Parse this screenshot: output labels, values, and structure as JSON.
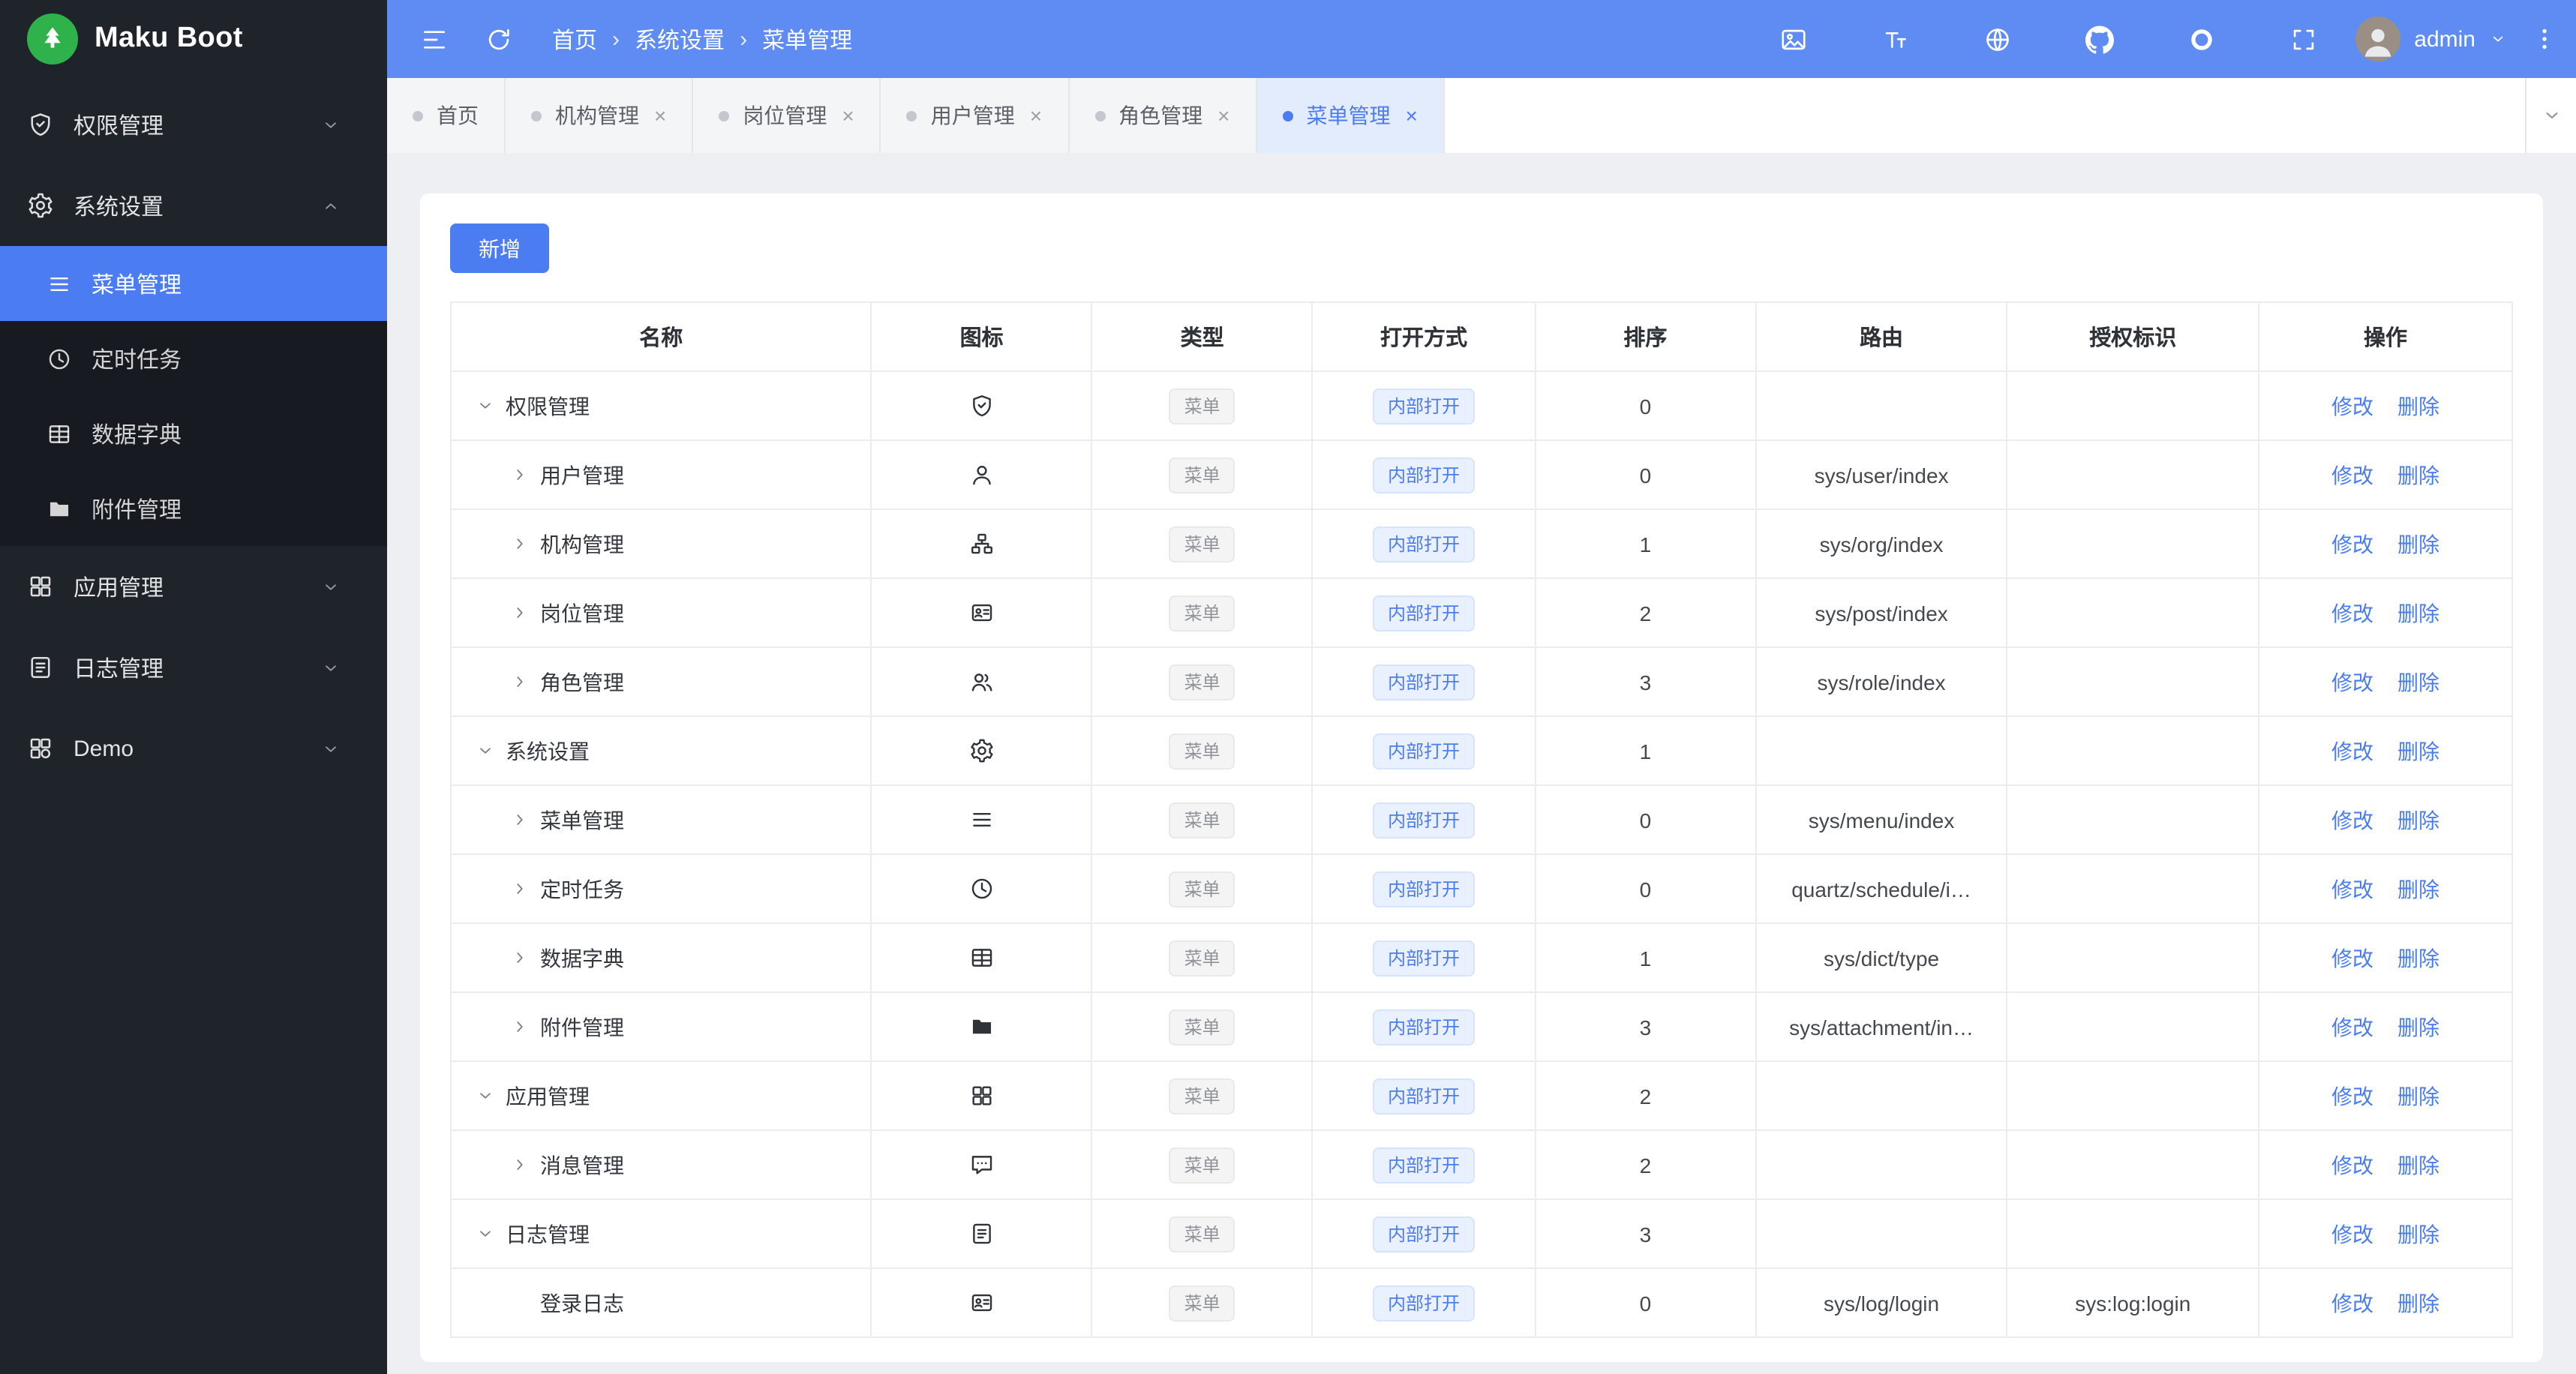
{
  "app": {
    "title": "Maku Boot",
    "logo_icon": "tree"
  },
  "colors": {
    "topbar": "#5f8cf3",
    "accent": "#4b7cf2",
    "sidebar_bg": "#1f232a",
    "submenu_bg": "#171a20",
    "logo_green": "#2fb24c",
    "content_bg": "#edeff3",
    "tag_gray_text": "#8f9399",
    "tag_blue_text": "#4b7cf2"
  },
  "header": {
    "left_icons": [
      "menu-fold",
      "refresh"
    ],
    "breadcrumb": [
      "首页",
      "系统设置",
      "菜单管理"
    ],
    "breadcrumb_separator": "›",
    "right_icons": [
      "image",
      "font-size",
      "globe",
      "github",
      "theme",
      "fullscreen"
    ],
    "user": "admin"
  },
  "sidebar": {
    "items": [
      {
        "label": "权限管理",
        "icon": "shield",
        "chevron": "down"
      },
      {
        "label": "系统设置",
        "icon": "gear",
        "chevron": "up",
        "children": [
          {
            "label": "菜单管理",
            "icon": "menu",
            "active": true
          },
          {
            "label": "定时任务",
            "icon": "clock"
          },
          {
            "label": "数据字典",
            "icon": "dict"
          },
          {
            "label": "附件管理",
            "icon": "folder"
          }
        ]
      },
      {
        "label": "应用管理",
        "icon": "apps",
        "chevron": "down"
      },
      {
        "label": "日志管理",
        "icon": "log",
        "chevron": "down"
      },
      {
        "label": "Demo",
        "icon": "demo",
        "chevron": "down"
      }
    ]
  },
  "tabs": {
    "close_glyph": "×",
    "items": [
      {
        "label": "首页",
        "closable": false
      },
      {
        "label": "机构管理",
        "closable": true
      },
      {
        "label": "岗位管理",
        "closable": true
      },
      {
        "label": "用户管理",
        "closable": true
      },
      {
        "label": "角色管理",
        "closable": true
      },
      {
        "label": "菜单管理",
        "closable": true,
        "active": true
      }
    ]
  },
  "toolbar": {
    "add_label": "新增"
  },
  "table": {
    "headers": [
      "名称",
      "图标",
      "类型",
      "打开方式",
      "排序",
      "路由",
      "授权标识",
      "操作"
    ],
    "type_tag": "菜单",
    "open_tag": "内部打开",
    "edit_label": "修改",
    "delete_label": "删除",
    "rows": [
      {
        "name": "权限管理",
        "icon": "shield",
        "caret": "down",
        "level": 0,
        "sort": "0",
        "route": "",
        "auth": ""
      },
      {
        "name": "用户管理",
        "icon": "user",
        "caret": "right",
        "level": 1,
        "sort": "0",
        "route": "sys/user/index",
        "auth": ""
      },
      {
        "name": "机构管理",
        "icon": "org",
        "caret": "right",
        "level": 1,
        "sort": "1",
        "route": "sys/org/index",
        "auth": ""
      },
      {
        "name": "岗位管理",
        "icon": "post",
        "caret": "right",
        "level": 1,
        "sort": "2",
        "route": "sys/post/index",
        "auth": ""
      },
      {
        "name": "角色管理",
        "icon": "role",
        "caret": "right",
        "level": 1,
        "sort": "3",
        "route": "sys/role/index",
        "auth": ""
      },
      {
        "name": "系统设置",
        "icon": "gear",
        "caret": "down",
        "level": 0,
        "sort": "1",
        "route": "",
        "auth": ""
      },
      {
        "name": "菜单管理",
        "icon": "menu",
        "caret": "right",
        "level": 1,
        "sort": "0",
        "route": "sys/menu/index",
        "auth": ""
      },
      {
        "name": "定时任务",
        "icon": "clock",
        "caret": "right",
        "level": 1,
        "sort": "0",
        "route": "quartz/schedule/i…",
        "auth": ""
      },
      {
        "name": "数据字典",
        "icon": "dict",
        "caret": "right",
        "level": 1,
        "sort": "1",
        "route": "sys/dict/type",
        "auth": ""
      },
      {
        "name": "附件管理",
        "icon": "folder",
        "caret": "right",
        "level": 1,
        "sort": "3",
        "route": "sys/attachment/in…",
        "auth": ""
      },
      {
        "name": "应用管理",
        "icon": "apps",
        "caret": "down",
        "level": 0,
        "sort": "2",
        "route": "",
        "auth": ""
      },
      {
        "name": "消息管理",
        "icon": "message",
        "caret": "right",
        "level": 1,
        "sort": "2",
        "route": "",
        "auth": ""
      },
      {
        "name": "日志管理",
        "icon": "log",
        "caret": "down",
        "level": 0,
        "sort": "3",
        "route": "",
        "auth": ""
      },
      {
        "name": "登录日志",
        "icon": "post",
        "caret": "none",
        "level": 1,
        "sort": "0",
        "route": "sys/log/login",
        "auth": "sys:log:login"
      }
    ]
  }
}
